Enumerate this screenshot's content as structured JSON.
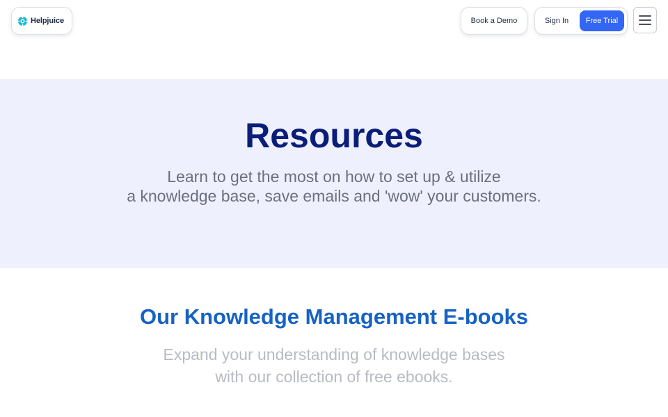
{
  "header": {
    "logo_text": "Helpjuice",
    "book_demo_label": "Book a Demo",
    "sign_in_label": "Sign In",
    "free_trial_label": "Free Trial",
    "menu_icon": "hamburger-menu-icon",
    "logo_icon": "helpjuice-logo-icon"
  },
  "hero": {
    "title": "Resources",
    "subtitle_line1": "Learn to get the most on how to set up & utilize",
    "subtitle_line2": "a knowledge base, save emails and 'wow' your customers."
  },
  "ebooks": {
    "title": "Our Knowledge Management E-books",
    "subtitle_line1": "Expand your understanding of knowledge bases",
    "subtitle_line2": "with our collection of free ebooks."
  },
  "colors": {
    "brand_blue": "#3366f5",
    "hero_title": "#0a1e78",
    "hero_bg": "#eef0fd",
    "section_title": "#1662c4"
  }
}
